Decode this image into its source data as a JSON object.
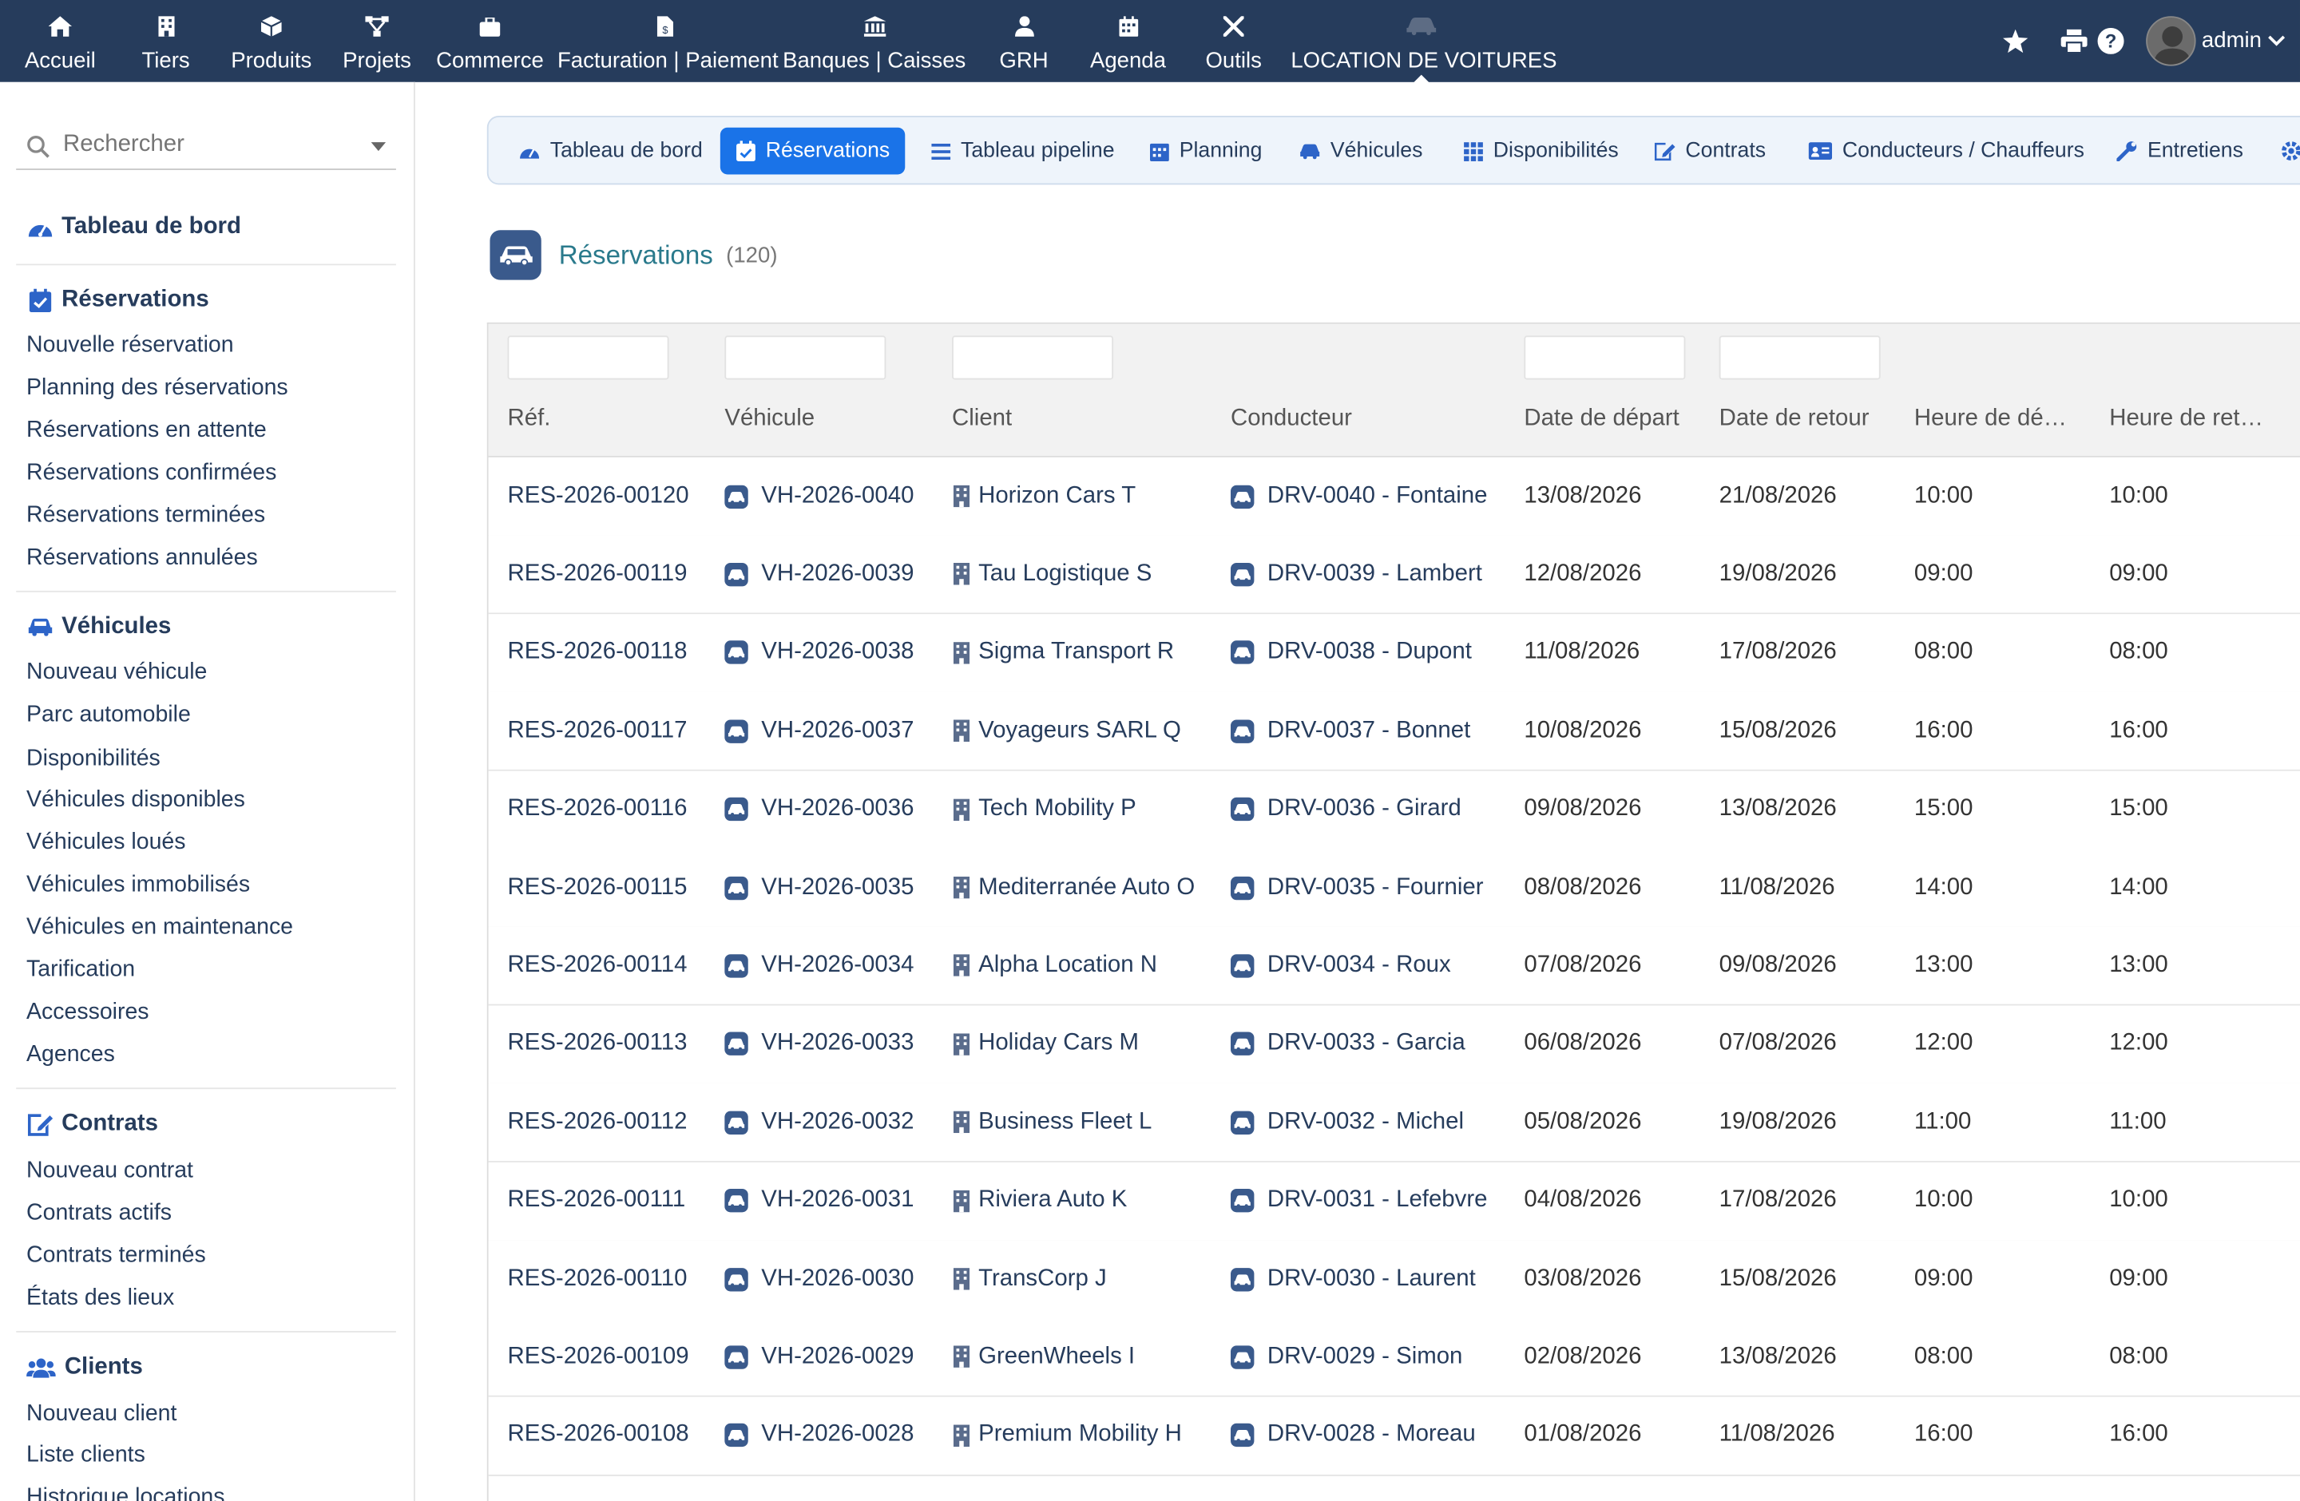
{
  "topnav": {
    "items": [
      {
        "label": "Accueil",
        "icon": "home-icon"
      },
      {
        "label": "Tiers",
        "icon": "building-icon"
      },
      {
        "label": "Produits",
        "icon": "cube-icon"
      },
      {
        "label": "Projets",
        "icon": "project-icon"
      },
      {
        "label": "Commerce",
        "icon": "briefcase-icon"
      },
      {
        "label": "Facturation | Paiement",
        "icon": "invoice-icon"
      },
      {
        "label": "Banques | Caisses",
        "icon": "bank-icon"
      },
      {
        "label": "GRH",
        "icon": "user-tie-icon"
      },
      {
        "label": "Agenda",
        "icon": "calendar-icon"
      },
      {
        "label": "Outils",
        "icon": "tools-icon"
      },
      {
        "label": "LOCATION DE VOITURES",
        "icon": "car-icon"
      }
    ],
    "user": "admin"
  },
  "sidebar": {
    "search_placeholder": "Rechercher",
    "dashboard": "Tableau de bord",
    "sections": [
      {
        "title": "Réservations",
        "icon": "calendar-check-icon",
        "links": [
          "Nouvelle réservation",
          "Planning des réservations",
          "Réservations en attente",
          "Réservations confirmées",
          "Réservations terminées",
          "Réservations annulées"
        ]
      },
      {
        "title": "Véhicules",
        "icon": "car-icon",
        "links": [
          "Nouveau véhicule",
          "Parc automobile",
          "Disponibilités",
          "Véhicules disponibles",
          "Véhicules loués",
          "Véhicules immobilisés",
          "Véhicules en maintenance",
          "Tarification",
          "Accessoires",
          "Agences"
        ]
      },
      {
        "title": "Contrats",
        "icon": "contract-icon",
        "links": [
          "Nouveau contrat",
          "Contrats actifs",
          "Contrats terminés",
          "États des lieux"
        ]
      },
      {
        "title": "Clients",
        "icon": "users-icon",
        "links": [
          "Nouveau client",
          "Liste clients",
          "Historique locations"
        ]
      }
    ]
  },
  "tabs": [
    {
      "label": "Tableau de bord",
      "icon": "gauge-icon"
    },
    {
      "label": "Réservations",
      "icon": "calendar-check-icon"
    },
    {
      "label": "Tableau pipeline",
      "icon": "list-icon"
    },
    {
      "label": "Planning",
      "icon": "calendar-icon"
    },
    {
      "label": "Véhicules",
      "icon": "car-icon"
    },
    {
      "label": "Disponibilités",
      "icon": "grid-icon"
    },
    {
      "label": "Contrats",
      "icon": "contract-icon"
    },
    {
      "label": "Conducteurs / Chauffeurs",
      "icon": "id-card-icon"
    },
    {
      "label": "Entretiens",
      "icon": "wrench-icon"
    }
  ],
  "page": {
    "title": "Réservations",
    "count": "(120)"
  },
  "table": {
    "columns": [
      "Réf.",
      "Véhicule",
      "Client",
      "Conducteur",
      "Date de départ",
      "Date de retour",
      "Heure de dé…",
      "Heure de ret…"
    ],
    "rows": [
      [
        "RES-2026-00120",
        "VH-2026-0040",
        "Horizon Cars T",
        "DRV-0040 - Fontaine",
        "13/08/2026",
        "21/08/2026",
        "10:00",
        "10:00"
      ],
      [
        "RES-2026-00119",
        "VH-2026-0039",
        "Tau Logistique S",
        "DRV-0039 - Lambert",
        "12/08/2026",
        "19/08/2026",
        "09:00",
        "09:00"
      ],
      [
        "RES-2026-00118",
        "VH-2026-0038",
        "Sigma Transport R",
        "DRV-0038 - Dupont",
        "11/08/2026",
        "17/08/2026",
        "08:00",
        "08:00"
      ],
      [
        "RES-2026-00117",
        "VH-2026-0037",
        "Voyageurs SARL Q",
        "DRV-0037 - Bonnet",
        "10/08/2026",
        "15/08/2026",
        "16:00",
        "16:00"
      ],
      [
        "RES-2026-00116",
        "VH-2026-0036",
        "Tech Mobility P",
        "DRV-0036 - Girard",
        "09/08/2026",
        "13/08/2026",
        "15:00",
        "15:00"
      ],
      [
        "RES-2026-00115",
        "VH-2026-0035",
        "Mediterranée Auto O",
        "DRV-0035 - Fournier",
        "08/08/2026",
        "11/08/2026",
        "14:00",
        "14:00"
      ],
      [
        "RES-2026-00114",
        "VH-2026-0034",
        "Alpha Location N",
        "DRV-0034 - Roux",
        "07/08/2026",
        "09/08/2026",
        "13:00",
        "13:00"
      ],
      [
        "RES-2026-00113",
        "VH-2026-0033",
        "Holiday Cars M",
        "DRV-0033 - Garcia",
        "06/08/2026",
        "07/08/2026",
        "12:00",
        "12:00"
      ],
      [
        "RES-2026-00112",
        "VH-2026-0032",
        "Business Fleet L",
        "DRV-0032 - Michel",
        "05/08/2026",
        "19/08/2026",
        "11:00",
        "11:00"
      ],
      [
        "RES-2026-00111",
        "VH-2026-0031",
        "Riviera Auto K",
        "DRV-0031 - Lefebvre",
        "04/08/2026",
        "17/08/2026",
        "10:00",
        "10:00"
      ],
      [
        "RES-2026-00110",
        "VH-2026-0030",
        "TransCorp J",
        "DRV-0030 - Laurent",
        "03/08/2026",
        "15/08/2026",
        "09:00",
        "09:00"
      ],
      [
        "RES-2026-00109",
        "VH-2026-0029",
        "GreenWheels I",
        "DRV-0029 - Simon",
        "02/08/2026",
        "13/08/2026",
        "08:00",
        "08:00"
      ],
      [
        "RES-2026-00108",
        "VH-2026-0028",
        "Premium Mobility H",
        "DRV-0028 - Moreau",
        "01/08/2026",
        "11/08/2026",
        "16:00",
        "16:00"
      ]
    ]
  },
  "colors": {
    "topbar": "#263c5c",
    "accent": "#1a73e8",
    "link": "#263c5c",
    "title": "#2a7a8c"
  }
}
